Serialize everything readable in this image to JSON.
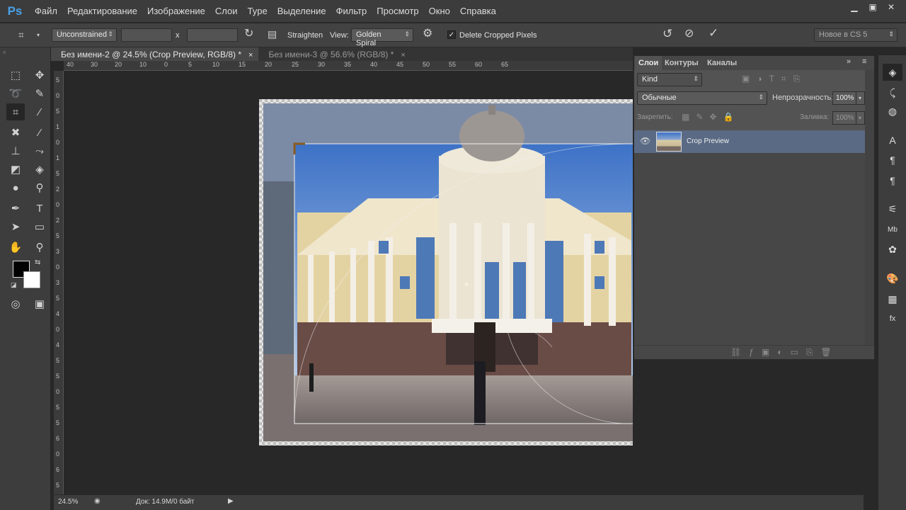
{
  "app": {
    "logo": "Ps"
  },
  "menu": [
    "Файл",
    "Редактирование",
    "Изображение",
    "Слои",
    "Type",
    "Выделение",
    "Фильтр",
    "Просмотр",
    "Окно",
    "Справка"
  ],
  "options": {
    "ratio": "Unconstrained",
    "x_sep": "x",
    "straighten": "Straighten",
    "view_label": "View:",
    "view_value": "Golden Spiral",
    "delete_cropped": "Delete Cropped Pixels",
    "workspace": "Новое в CS 5"
  },
  "tabs": [
    {
      "label": "Без имени-2 @ 24.5% (Crop Preview, RGB/8) *",
      "close": "×"
    },
    {
      "label": "Без имени-3 @ 56.6% (RGB/8) *",
      "close": "×"
    }
  ],
  "hruler": [
    "40",
    "30",
    "20",
    "10",
    "0",
    "5",
    "10",
    "15",
    "20",
    "25",
    "30",
    "35",
    "40",
    "45",
    "50",
    "55",
    "60",
    "65"
  ],
  "vruler": [
    "5",
    "0",
    "5",
    "1",
    "0",
    "1",
    "5",
    "2",
    "0",
    "2",
    "5",
    "3",
    "0",
    "3",
    "5",
    "4",
    "0",
    "4",
    "5",
    "5",
    "0",
    "5",
    "5",
    "6",
    "0",
    "6",
    "5"
  ],
  "status": {
    "zoom": "24.5%",
    "doc": "Док: 14.9M/0 байт"
  },
  "layers_panel": {
    "tabs": [
      "Слои",
      "Контуры",
      "Каналы"
    ],
    "kind": "Kind",
    "blend": "Обычные",
    "opacity_label": "Непрозрачность:",
    "opacity": "100%",
    "lock_label": "Закрепить:",
    "fill_label": "Заливка:",
    "fill": "100%",
    "layer_name": "Crop Preview"
  }
}
